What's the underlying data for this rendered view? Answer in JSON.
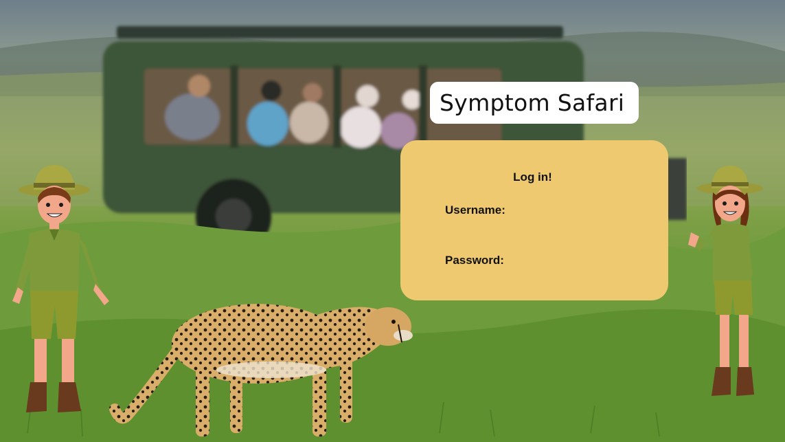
{
  "app": {
    "title": "Symptom Safari"
  },
  "login": {
    "heading": "Log in!",
    "username_label": "Username:",
    "username_value": "",
    "password_label": "Password:",
    "password_value": ""
  },
  "scene": {
    "background": "safari-savanna-photo",
    "vehicle": "safari-jeep",
    "animal": "cheetah",
    "characters": [
      "ranger-boy",
      "ranger-girl"
    ]
  },
  "colors": {
    "login_card": "#eec96f",
    "title_card": "#ffffff",
    "grass": "#6e9a3b"
  }
}
